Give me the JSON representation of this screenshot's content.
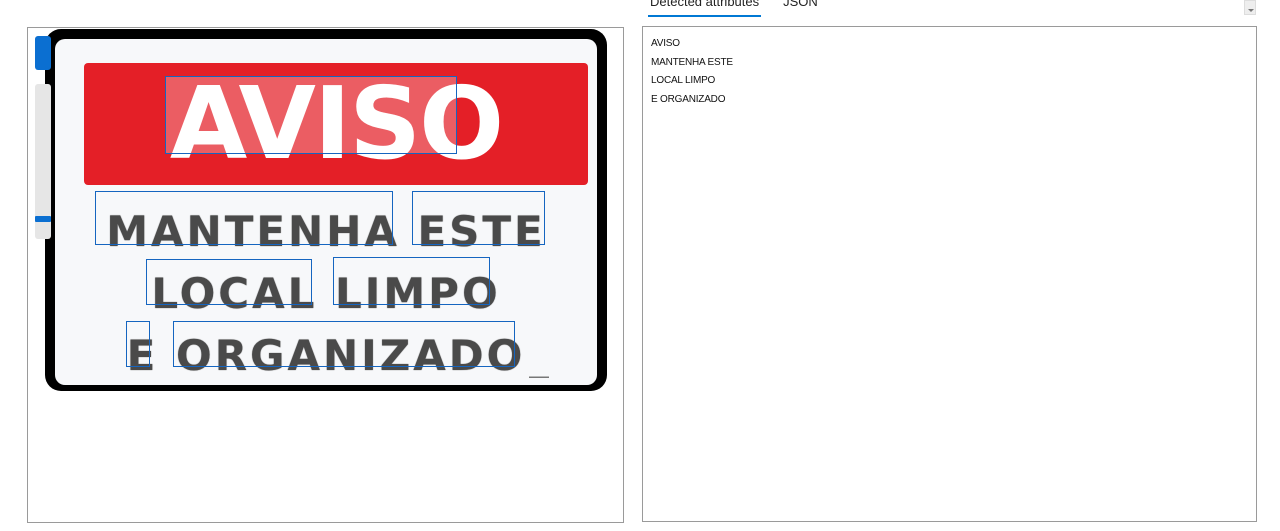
{
  "tabs": [
    {
      "label": "Detected attributes",
      "active": true
    },
    {
      "label": "JSON",
      "active": false
    }
  ],
  "image": {
    "sign_heading": "AVISO",
    "sign_line_1": "MANTENHA ESTE",
    "sign_line_2": "LOCAL LIMPO",
    "sign_line_3": "E ORGANIZADO",
    "colors": {
      "band": "#e41f27",
      "box": "#1565c0",
      "accent": "#0b6fd1"
    }
  },
  "detected_lines": [
    "AVISO",
    "MANTENHA ESTE",
    "LOCAL LIMPO",
    "E ORGANIZADO"
  ],
  "zoom": {
    "level_fraction": 0.9
  }
}
